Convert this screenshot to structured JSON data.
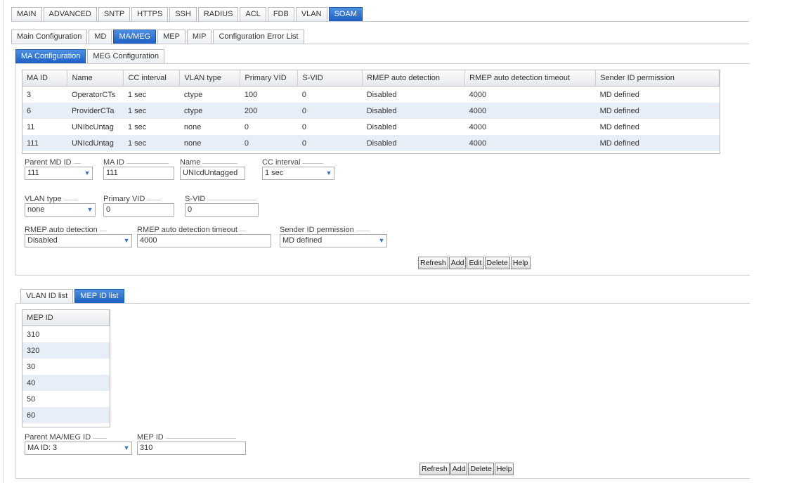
{
  "main_tabs": [
    "MAIN",
    "ADVANCED",
    "SNTP",
    "HTTPS",
    "SSH",
    "RADIUS",
    "ACL",
    "FDB",
    "VLAN",
    "SOAM"
  ],
  "main_tab_active": 9,
  "soam_tabs": [
    "Main Configuration",
    "MD",
    "MA/MEG",
    "MEP",
    "MIP",
    "Configuration Error List"
  ],
  "soam_tab_active": 2,
  "mameg_tabs": [
    "MA Configuration",
    "MEG Configuration"
  ],
  "mameg_tab_active": 0,
  "ma_table": {
    "columns": [
      "MA ID",
      "Name",
      "CC interval",
      "VLAN type",
      "Primary VID",
      "S-VID",
      "RMEP auto detection",
      "RMEP auto detection timeout",
      "Sender ID permission"
    ],
    "rows": [
      [
        "3",
        "OperatorCTs",
        "1 sec",
        "ctype",
        "100",
        "0",
        "Disabled",
        "4000",
        "MD defined"
      ],
      [
        "6",
        "ProviderCTa",
        "1 sec",
        "ctype",
        "200",
        "0",
        "Disabled",
        "4000",
        "MD defined"
      ],
      [
        "11",
        "UNIbcUntag",
        "1 sec",
        "none",
        "0",
        "0",
        "Disabled",
        "4000",
        "MD defined"
      ],
      [
        "111",
        "UNIcdUntag",
        "1 sec",
        "none",
        "0",
        "0",
        "Disabled",
        "4000",
        "MD defined"
      ]
    ]
  },
  "ma_form": {
    "parent_md_id": {
      "label": "Parent MD ID",
      "value": "111"
    },
    "ma_id": {
      "label": "MA ID",
      "value": "111"
    },
    "name": {
      "label": "Name",
      "value": "UNIcdUntagged"
    },
    "cc_interval": {
      "label": "CC interval",
      "value": "1 sec"
    },
    "vlan_type": {
      "label": "VLAN type",
      "value": "none"
    },
    "primary_vid": {
      "label": "Primary VID",
      "value": "0"
    },
    "s_vid": {
      "label": "S-VID",
      "value": "0"
    },
    "rmep_auto_detection": {
      "label": "RMEP auto detection",
      "value": "Disabled"
    },
    "rmep_timeout": {
      "label": "RMEP auto detection timeout",
      "value": "4000"
    },
    "sender_id": {
      "label": "Sender ID permission",
      "value": "MD defined"
    }
  },
  "ma_buttons": {
    "refresh": "Refresh",
    "add": "Add",
    "edit": "Edit",
    "delete": "Delete",
    "help": "Help"
  },
  "sub_tabs": [
    "VLAN ID list",
    "MEP ID list"
  ],
  "sub_tab_active": 1,
  "mep_table": {
    "header": "MEP ID",
    "rows": [
      "310",
      "320",
      "30",
      "40",
      "50",
      "60"
    ]
  },
  "mep_form": {
    "parent_ma": {
      "label": "Parent MA/MEG ID",
      "value": "MA ID: 3"
    },
    "mep_id": {
      "label": "MEP ID",
      "value": "310"
    }
  },
  "mep_buttons": {
    "refresh": "Refresh",
    "add": "Add",
    "delete": "Delete",
    "help": "Help"
  },
  "icons": {
    "dropdown": "chevron-down-icon"
  },
  "colors": {
    "active_tab": "#1d5fc4",
    "alt_row": "#e8eef8"
  }
}
